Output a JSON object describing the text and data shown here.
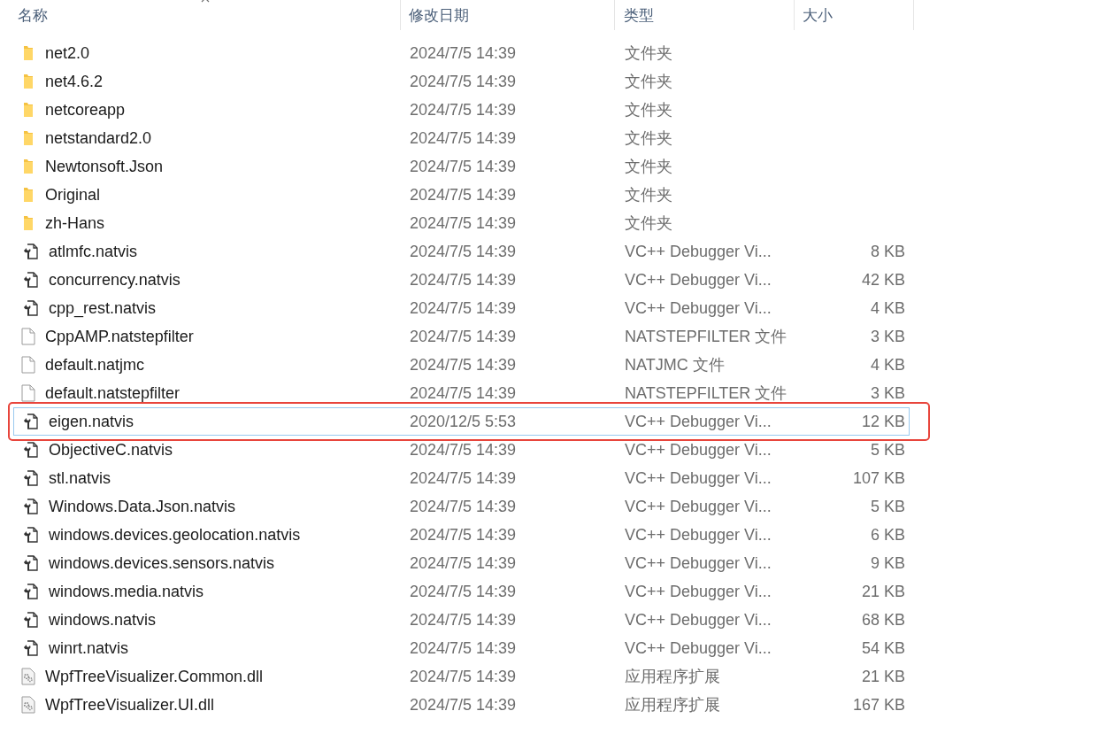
{
  "columns": [
    {
      "label": "名称",
      "sorted": true
    },
    {
      "label": "修改日期",
      "sorted": false
    },
    {
      "label": "类型",
      "sorted": false
    },
    {
      "label": "大小",
      "sorted": false
    }
  ],
  "rows": [
    {
      "kind": "folder",
      "name": "net2.0",
      "date": "2024/7/5 14:39",
      "type": "文件夹",
      "selected": false,
      "highlighted": false
    },
    {
      "kind": "folder",
      "name": "net4.6.2",
      "date": "2024/7/5 14:39",
      "type": "文件夹",
      "selected": false,
      "highlighted": false
    },
    {
      "kind": "folder",
      "name": "netcoreapp",
      "date": "2024/7/5 14:39",
      "type": "文件夹",
      "selected": false,
      "highlighted": false
    },
    {
      "kind": "folder",
      "name": "netstandard2.0",
      "date": "2024/7/5 14:39",
      "type": "文件夹",
      "selected": false,
      "highlighted": false
    },
    {
      "kind": "folder",
      "name": "Newtonsoft.Json",
      "date": "2024/7/5 14:39",
      "type": "文件夹",
      "selected": false,
      "highlighted": false
    },
    {
      "kind": "folder",
      "name": "Original",
      "date": "2024/7/5 14:39",
      "type": "文件夹",
      "selected": false,
      "highlighted": false
    },
    {
      "kind": "folder",
      "name": "zh-Hans",
      "date": "2024/7/5 14:39",
      "type": "文件夹",
      "selected": false,
      "highlighted": false
    },
    {
      "kind": "natvis",
      "name": "atlmfc.natvis",
      "date": "2024/7/5 14:39",
      "type": "VC++ Debugger Vi...",
      "size": "8 KB",
      "selected": false,
      "highlighted": false
    },
    {
      "kind": "natvis",
      "name": "concurrency.natvis",
      "date": "2024/7/5 14:39",
      "type": "VC++ Debugger Vi...",
      "size": "42 KB",
      "selected": false,
      "highlighted": false
    },
    {
      "kind": "natvis",
      "name": "cpp_rest.natvis",
      "date": "2024/7/5 14:39",
      "type": "VC++ Debugger Vi...",
      "size": "4 KB",
      "selected": false,
      "highlighted": false
    },
    {
      "kind": "file",
      "name": "CppAMP.natstepfilter",
      "date": "2024/7/5 14:39",
      "type": "NATSTEPFILTER 文件",
      "size": "3 KB",
      "selected": false,
      "highlighted": false
    },
    {
      "kind": "file",
      "name": "default.natjmc",
      "date": "2024/7/5 14:39",
      "type": "NATJMC 文件",
      "size": "4 KB",
      "selected": false,
      "highlighted": false
    },
    {
      "kind": "file",
      "name": "default.natstepfilter",
      "date": "2024/7/5 14:39",
      "type": "NATSTEPFILTER 文件",
      "size": "3 KB",
      "selected": false,
      "highlighted": false
    },
    {
      "kind": "natvis",
      "name": "eigen.natvis",
      "date": "2020/12/5 5:53",
      "type": "VC++ Debugger Vi...",
      "size": "12 KB",
      "selected": true,
      "highlighted": true
    },
    {
      "kind": "natvis",
      "name": "ObjectiveC.natvis",
      "date": "2024/7/5 14:39",
      "type": "VC++ Debugger Vi...",
      "size": "5 KB",
      "selected": false,
      "highlighted": false
    },
    {
      "kind": "natvis",
      "name": "stl.natvis",
      "date": "2024/7/5 14:39",
      "type": "VC++ Debugger Vi...",
      "size": "107 KB",
      "selected": false,
      "highlighted": false
    },
    {
      "kind": "natvis",
      "name": "Windows.Data.Json.natvis",
      "date": "2024/7/5 14:39",
      "type": "VC++ Debugger Vi...",
      "size": "5 KB",
      "selected": false,
      "highlighted": false
    },
    {
      "kind": "natvis",
      "name": "windows.devices.geolocation.natvis",
      "date": "2024/7/5 14:39",
      "type": "VC++ Debugger Vi...",
      "size": "6 KB",
      "selected": false,
      "highlighted": false
    },
    {
      "kind": "natvis",
      "name": "windows.devices.sensors.natvis",
      "date": "2024/7/5 14:39",
      "type": "VC++ Debugger Vi...",
      "size": "9 KB",
      "selected": false,
      "highlighted": false
    },
    {
      "kind": "natvis",
      "name": "windows.media.natvis",
      "date": "2024/7/5 14:39",
      "type": "VC++ Debugger Vi...",
      "size": "21 KB",
      "selected": false,
      "highlighted": false
    },
    {
      "kind": "natvis",
      "name": "windows.natvis",
      "date": "2024/7/5 14:39",
      "type": "VC++ Debugger Vi...",
      "size": "68 KB",
      "selected": false,
      "highlighted": false
    },
    {
      "kind": "natvis",
      "name": "winrt.natvis",
      "date": "2024/7/5 14:39",
      "type": "VC++ Debugger Vi...",
      "size": "54 KB",
      "selected": false,
      "highlighted": false
    },
    {
      "kind": "dll",
      "name": "WpfTreeVisualizer.Common.dll",
      "date": "2024/7/5 14:39",
      "type": "应用程序扩展",
      "size": "21 KB",
      "selected": false,
      "highlighted": false
    },
    {
      "kind": "dll",
      "name": "WpfTreeVisualizer.UI.dll",
      "date": "2024/7/5 14:39",
      "type": "应用程序扩展",
      "size": "167 KB",
      "selected": false,
      "highlighted": false
    }
  ]
}
